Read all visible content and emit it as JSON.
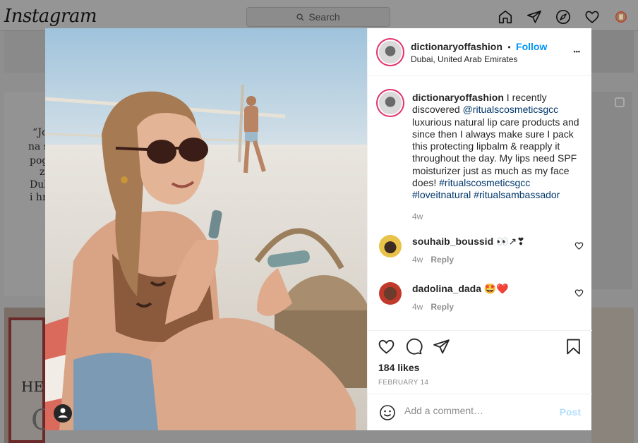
{
  "nav": {
    "logo": "Instagram",
    "search_placeholder": "Search",
    "icons": [
      "home-icon",
      "direct-icon",
      "explore-icon",
      "activity-heart-icon",
      "profile-avatar"
    ]
  },
  "background": {
    "quote_lines": [
      "“Jo",
      "na s",
      "pog",
      "z",
      "Dul",
      "i hr"
    ],
    "tile_text_1": "HE",
    "tile_text_2": "C"
  },
  "post": {
    "username": "dictionaryoffashion",
    "separator": "•",
    "follow_label": "Follow",
    "location": "Dubai, United Arab Emirates",
    "more_label": "•••",
    "caption": {
      "username": "dictionaryoffashion",
      "text_1": " I recently discovered ",
      "mention": "@ritualscosmeticsgcc",
      "text_2": " luxurious natural lip care products and since then I always make sure I pack this protecting lipbalm & reapply it throughout the day. My lips need SPF moisturizer just as much as my face does! ",
      "hashtag_1": "#ritualscosmeticsgcc",
      "hashtag_2": "#loveitnatural",
      "hashtag_3": "#ritualsambassador",
      "time": "4w"
    },
    "comments": [
      {
        "username": "souhaib_boussid",
        "text": " 👀↗❣",
        "time": "4w",
        "reply": "Reply"
      },
      {
        "username": "dadolina_dada",
        "text": " 🤩❤️",
        "time": "4w",
        "reply": "Reply"
      }
    ],
    "likes": "184 likes",
    "date": "FEBRUARY 14",
    "add_comment_placeholder": "Add a comment…",
    "post_label": "Post"
  },
  "colors": {
    "link": "#00376b",
    "follow": "#0095f6",
    "post_disabled": "#b2dffc",
    "story_ring": "#e1306c"
  }
}
